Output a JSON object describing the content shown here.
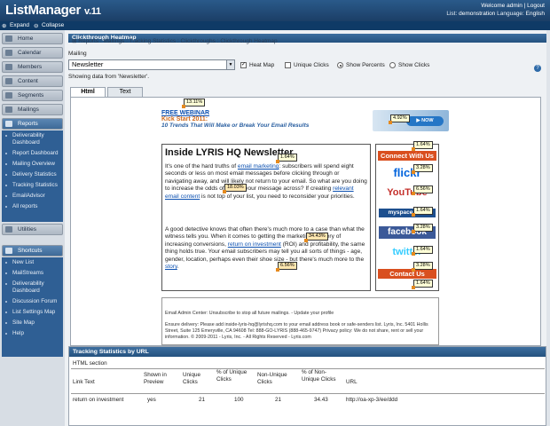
{
  "app": {
    "name": "ListManager",
    "version": "v.11"
  },
  "header": {
    "welcome": "Welcome admin | Logout",
    "list_label": "List:",
    "list_value": "demonstration",
    "language_label": "Language:",
    "language_value": "English"
  },
  "nav": {
    "expand": "Expand",
    "collapse": "Collapse"
  },
  "sidebar": {
    "items": [
      "Home",
      "Calendar",
      "Members",
      "Content",
      "Segments",
      "Mailings",
      "Reports"
    ],
    "reports_sub": [
      "Deliverability Dashboard",
      "Report Dashboard",
      "Mailing Overview",
      "Delivery Statistics",
      "Tracking Statistics",
      "EmailAdvisor",
      "All reports"
    ],
    "utilities": "Utilities",
    "shortcuts": "Shortcuts",
    "shortcut_items": [
      "New List",
      "MailStreams",
      "Deliverability Dashboard",
      "Discussion Forum",
      "List Settings Map",
      "Site Map",
      "Help"
    ]
  },
  "page": {
    "title": "Clickthrough Heatmap",
    "breadcrumb": [
      "Reports",
      "Mailings",
      "Tracking Statistics",
      "Clickthroughs",
      "Clickthrough Heatmap"
    ],
    "help": "?",
    "mailing_label": "Mailing",
    "mailing_value": "Newsletter",
    "heatmap_label": "Heat Map",
    "unique_clicks_label": "Unique Clicks",
    "show_percents_label": "Show Percents",
    "show_clicks_label": "Show Clicks",
    "showing_data": "Showing data from 'Newsletter'.",
    "tabs": [
      "Html",
      "Text"
    ]
  },
  "newsletter": {
    "webinar_link": "FREE WEBINAR",
    "kickstart": "Kick Start 2011:",
    "tagline": "10 Trends That Will Make or Break Your Email Results",
    "title": "Inside LYRIS HQ Newsletter",
    "p1_a": "It's one of the hard truths of ",
    "p1_link1": "email marketing",
    "p1_b": ": subscribers will spend eight seconds or less on most email messages before clicking through or navigating away, and will likely not return to your email. So what are you doing to increase the odds of getting your message across? If creating ",
    "p1_link2": "relevant email content",
    "p1_c": " is not top of your list, you need to reconsider your priorities.",
    "p2_a": "A good detective knows that often there's much more to a case than what the witness tells you. When it comes to getting the marketing mystery of increasing conversions, ",
    "p2_link1": "return on investment",
    "p2_b": " (ROI) and profitability, the same thing holds true. Your email subscribers may tell you all sorts of things - age, gender, location, perhaps even their shoe size - but there's much more to the ",
    "p2_link2": "story",
    "p2_c": ".",
    "connect": "Connect With Us",
    "social": [
      "flickr",
      "YouTube",
      "myspace.com",
      "facebook",
      "twitter"
    ],
    "contact": "Contact Us",
    "footer1": "Email Admin Center: Unsubscribe to stop all future mailings. - Update your profile",
    "footer2": "Ensure delivery: Please add inside-lyris-hq@lyrishq.com to your email address book or safe-senders list. Lyris, Inc. 5401 Hollis Street, Suite 125 Emeryville, CA 94608 Tel: 888-GO-LYRIS (888-465-9747) Privacy policy: We do not share, rent or sell your information. © 2009-2011 - Lyris, Inc. - All Rights Reserved - Lyris.com",
    "tooltips": [
      "13.11%",
      "4.92%",
      "1.64%",
      "18.03%",
      "1.64%",
      "3.28%",
      "6.56%",
      "1.64%",
      "3.28%",
      "1.64%",
      "3.28%",
      "34.43%",
      "6.56%",
      "1.64%"
    ]
  },
  "tracking": {
    "title": "Tracking Statistics by URL",
    "section": "HTML section",
    "columns": [
      "Link Text",
      "Shown in Preview",
      "Unique Clicks",
      "% of Unique Clicks",
      "Non-Unique Clicks",
      "% of Non-Unique Clicks",
      "URL"
    ],
    "rows": [
      {
        "link_text": "return on investment",
        "shown": "yes",
        "unique": "21",
        "pct_unique": "100",
        "non_unique": "21",
        "pct_non_unique": "34.43",
        "url": "http://oa-xp-3/ee/ddd"
      }
    ]
  },
  "colors": {
    "header": "#1b3e66",
    "accent_orange": "#d94f1f",
    "link": "#0a4fb0"
  }
}
